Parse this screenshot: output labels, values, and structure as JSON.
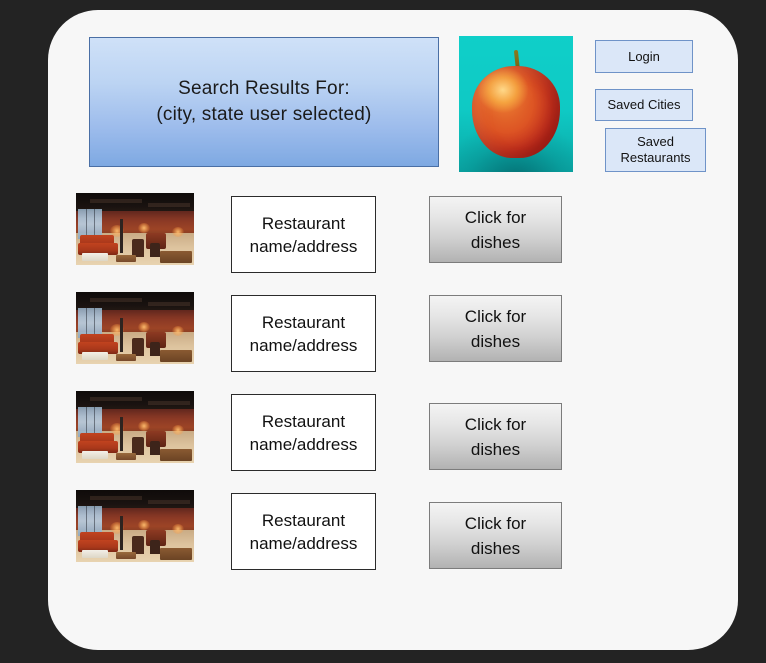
{
  "page": {
    "background_color": "#232323",
    "card_color": "#f7f7f7"
  },
  "banner": {
    "line1": "Search Results For:",
    "line2": "(city, state user selected)",
    "gradient_top": "#cfe1f8",
    "gradient_bottom": "#7ea9e2",
    "border_color": "#4a6fa5"
  },
  "hero_image": {
    "alt": "apple-photo",
    "subject": "red apple",
    "background_color": "#0fcfc9",
    "apple_color": "#d8501f",
    "stem_color": "#7c6c18"
  },
  "nav_buttons": [
    {
      "id": "login",
      "label": "Login"
    },
    {
      "id": "saved-cities",
      "label": "Saved Cities"
    },
    {
      "id": "saved-restaurants",
      "label": "Saved\nRestaurants",
      "line1": "Saved",
      "line2": "Restaurants"
    }
  ],
  "nav_button_style": {
    "background": "#dbe7f8",
    "border": "#6f93c8"
  },
  "results": [
    {
      "thumbnail_alt": "restaurant-interior-photo",
      "name_line1": "Restaurant",
      "name_line2": "name/address",
      "button_line1": "Click for",
      "button_line2": "dishes"
    },
    {
      "thumbnail_alt": "restaurant-interior-photo",
      "name_line1": "Restaurant",
      "name_line2": "name/address",
      "button_line1": "Click for",
      "button_line2": "dishes"
    },
    {
      "thumbnail_alt": "restaurant-interior-photo",
      "name_line1": "Restaurant",
      "name_line2": "name/address",
      "button_line1": "Click for",
      "button_line2": "dishes"
    },
    {
      "thumbnail_alt": "restaurant-interior-photo",
      "name_line1": "Restaurant",
      "name_line2": "name/address",
      "button_line1": "Click for",
      "button_line2": "dishes"
    }
  ],
  "result_button_style": {
    "gradient_top": "#f4f4f4",
    "gradient_bottom": "#b2b2b2",
    "border": "#7c7c7c"
  }
}
